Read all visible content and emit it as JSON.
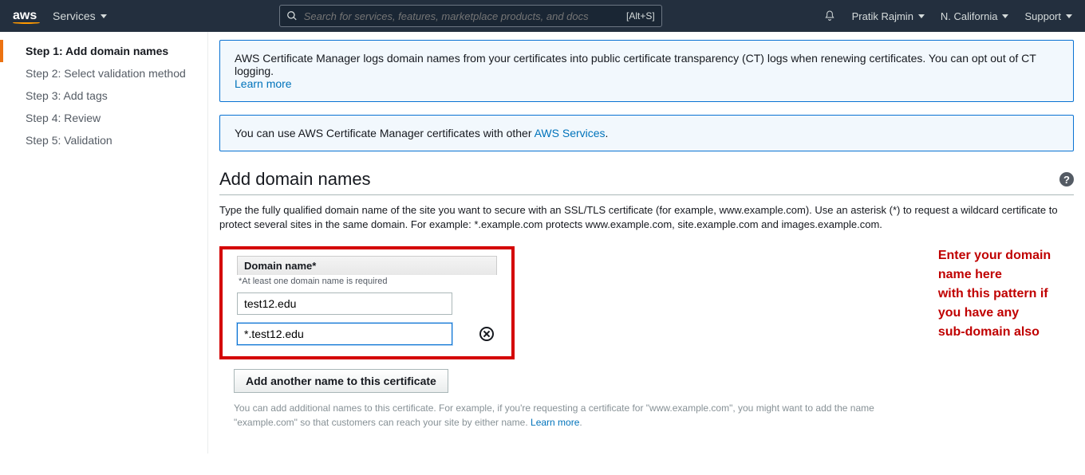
{
  "top": {
    "logo": "aws",
    "services": "Services",
    "search_placeholder": "Search for services, features, marketplace products, and docs",
    "search_shortcut": "[Alt+S]",
    "user": "Pratik Rajmin",
    "region": "N. California",
    "support": "Support"
  },
  "sidebar": {
    "steps": [
      {
        "label": "Step 1: Add domain names",
        "active": true
      },
      {
        "label": "Step 2: Select validation method",
        "active": false
      },
      {
        "label": "Step 3: Add tags",
        "active": false
      },
      {
        "label": "Step 4: Review",
        "active": false
      },
      {
        "label": "Step 5: Validation",
        "active": false
      }
    ]
  },
  "info1": {
    "text": "AWS Certificate Manager logs domain names from your certificates into public certificate transparency (CT) logs when renewing certificates. You can opt out of CT logging.",
    "link": "Learn more"
  },
  "info2": {
    "text_before": "You can use AWS Certificate Manager certificates with other ",
    "link": "AWS Services",
    "text_after": "."
  },
  "section": {
    "title": "Add domain names",
    "desc": "Type the fully qualified domain name of the site you want to secure with an SSL/TLS certificate (for example, www.example.com). Use an asterisk (*) to request a wildcard certificate to protect several sites in the same domain. For example: *.example.com protects www.example.com, site.example.com and images.example.com."
  },
  "form": {
    "header": "Domain name*",
    "required_note": "*At least one domain name is required",
    "domain1": "test12.edu",
    "domain2": "*.test12.edu",
    "add_button": "Add another name to this certificate",
    "footer_note_before": "You can add additional names to this certificate. For example, if you're requesting a certificate for \"www.example.com\", you might want to add the name \"example.com\" so that customers can reach your site by either name. ",
    "footer_link": "Learn more"
  },
  "callout": {
    "line1": "Enter your domain name here",
    "line2": "with this pattern if you have any",
    "line3": "sub-domain also"
  }
}
